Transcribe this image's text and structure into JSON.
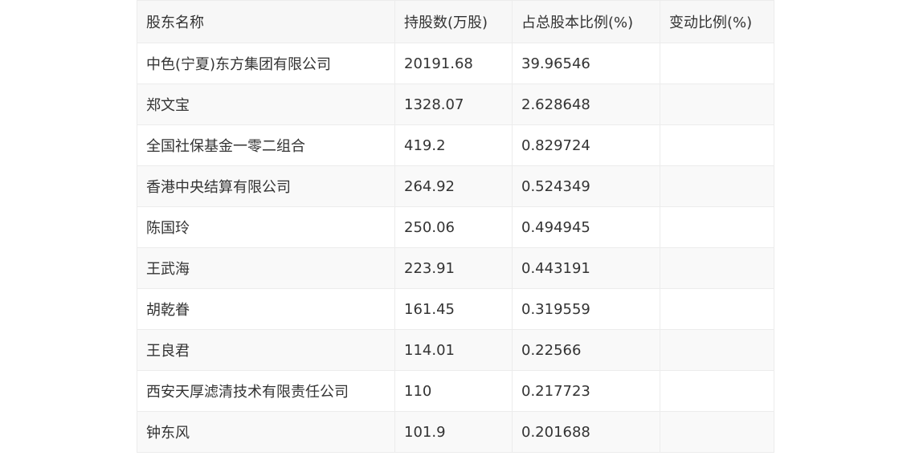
{
  "table": {
    "headers": [
      "股东名称",
      "持股数(万股)",
      "占总股本比例(%)",
      "变动比例(%)"
    ],
    "rows": [
      [
        "中色(宁夏)东方集团有限公司",
        "20191.68",
        "39.96546",
        ""
      ],
      [
        "郑文宝",
        "1328.07",
        "2.628648",
        ""
      ],
      [
        "全国社保基金一零二组合",
        "419.2",
        "0.829724",
        ""
      ],
      [
        "香港中央结算有限公司",
        "264.92",
        "0.524349",
        ""
      ],
      [
        "陈国玲",
        "250.06",
        "0.494945",
        ""
      ],
      [
        "王武海",
        "223.91",
        "0.443191",
        ""
      ],
      [
        "胡乾眷",
        "161.45",
        "0.319559",
        ""
      ],
      [
        "王良君",
        "114.01",
        "0.22566",
        ""
      ],
      [
        "西安天厚滤清技术有限责任公司",
        "110",
        "0.217723",
        ""
      ],
      [
        "钟东风",
        "101.9",
        "0.201688",
        ""
      ]
    ]
  }
}
